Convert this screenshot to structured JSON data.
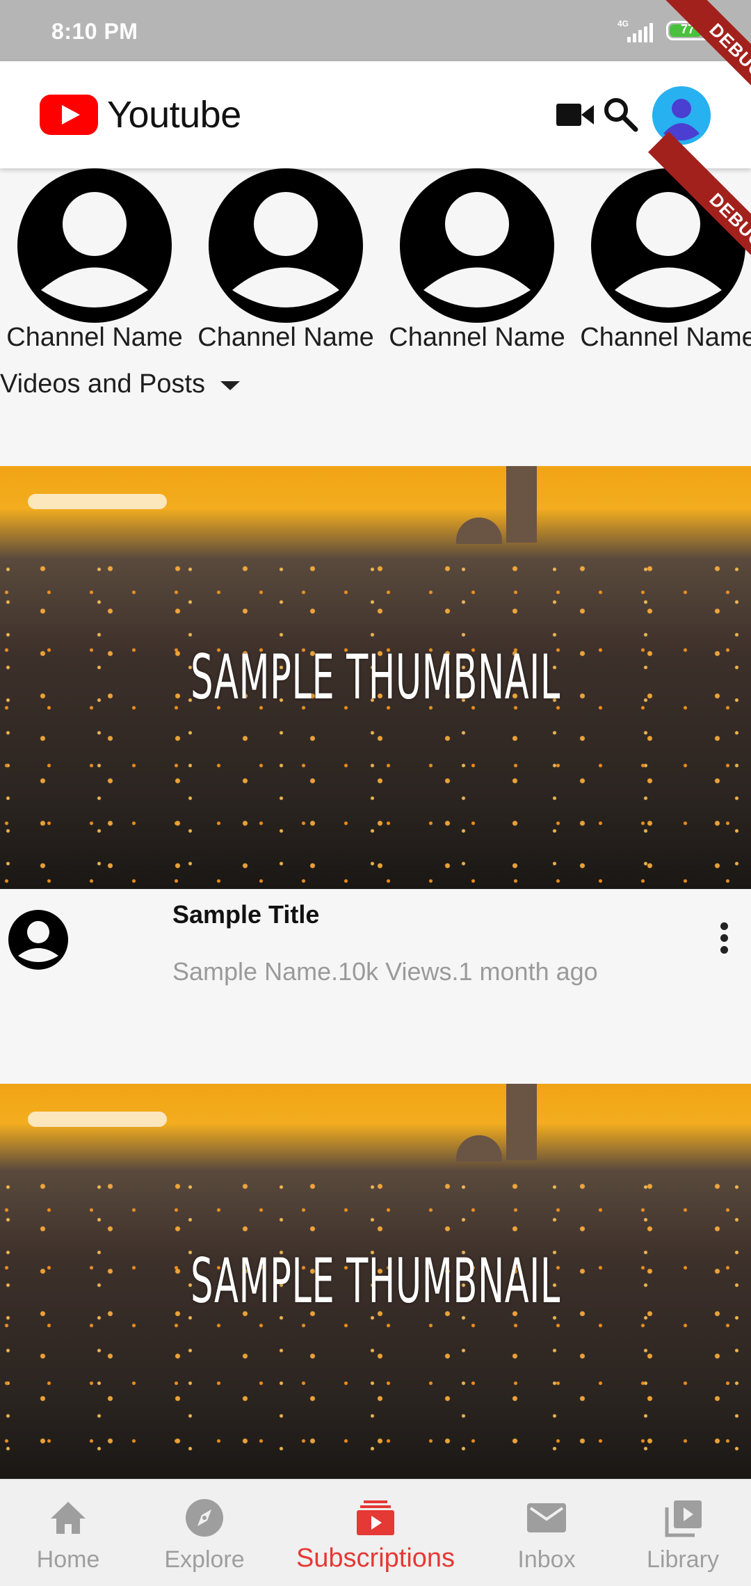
{
  "status_bar": {
    "time": "8:10 PM",
    "network": "4G",
    "battery_level": "77",
    "battery_color": "#49c13d"
  },
  "app_bar": {
    "title": "Youtube",
    "logo_color": "#ff0000",
    "icons": [
      "videocam-icon",
      "search-icon",
      "account-avatar-icon"
    ]
  },
  "channels": [
    {
      "name": "Channel Name"
    },
    {
      "name": "Channel Name"
    },
    {
      "name": "Channel Name"
    },
    {
      "name": "Channel Name"
    }
  ],
  "filter": {
    "label": "Videos and Posts"
  },
  "videos": [
    {
      "thumbnail_text": "SAMPLE THUMBNAIL",
      "title": "Sample Title",
      "channel": "Sample Name",
      "views": "10k Views",
      "age": "1 month ago",
      "subtitle": "Sample Name.10k Views.1 month ago"
    },
    {
      "thumbnail_text": "SAMPLE THUMBNAIL"
    }
  ],
  "debug_banner": "DEBUG",
  "bottom_nav": {
    "active_color": "#e53935",
    "inactive_color": "#9e9e9e",
    "items": [
      {
        "label": "Home",
        "icon": "home-icon"
      },
      {
        "label": "Explore",
        "icon": "compass-icon"
      },
      {
        "label": "Subscriptions",
        "icon": "subscriptions-icon",
        "active": true
      },
      {
        "label": "Inbox",
        "icon": "mail-icon"
      },
      {
        "label": "Library",
        "icon": "library-icon"
      }
    ]
  }
}
